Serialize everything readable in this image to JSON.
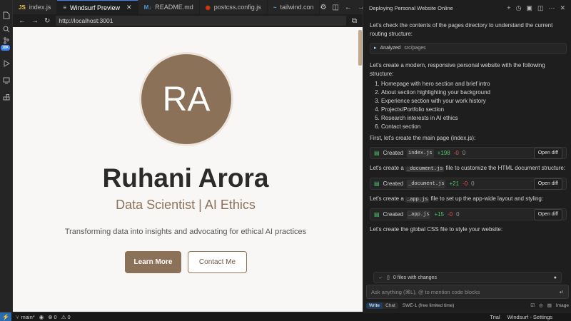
{
  "tabs": [
    {
      "icon": "JS",
      "label": "index.js",
      "active": false
    },
    {
      "icon": "≡",
      "label": "Windsurf Preview",
      "active": true
    },
    {
      "icon": "M↓",
      "label": "README.md",
      "active": false
    },
    {
      "icon": "◉",
      "label": "postcss.config.js",
      "active": false
    },
    {
      "icon": "~",
      "label": "tailwind.con",
      "active": false
    }
  ],
  "address": {
    "url": "http://localhost:3001"
  },
  "activity_badge": "10K",
  "preview": {
    "avatar_initials": "RA",
    "name": "Ruhani Arora",
    "role": "Data Scientist | AI Ethics",
    "tagline": "Transforming data into insights and advocating for ethical AI practices",
    "primary_button": "Learn More",
    "secondary_button": "Contact Me"
  },
  "chat": {
    "title": "Deploying Personal Website Online",
    "intro": "Let's check the contents of the pages directory to understand the current routing structure:",
    "analyzed_label": "Analyzed",
    "analyzed_path": "src/pages",
    "plan_intro": "Let's create a modern, responsive personal website with the following structure:",
    "plan_items": [
      "Homepage with hero section and brief intro",
      "About section highlighting your background",
      "Experience section with your work history",
      "Projects/Portfolio section",
      "Research interests in AI ethics",
      "Contact section"
    ],
    "main_page_text": "First, let's create the main page (index.js):",
    "created_label": "Created",
    "open_diff_label": "Open diff",
    "files": [
      {
        "name": "index.js",
        "added": "+198",
        "removed": "-0",
        "other": "0"
      },
      {
        "name": "_document.js",
        "added": "+21",
        "removed": "-0",
        "other": "0"
      },
      {
        "name": "_app.js",
        "added": "+15",
        "removed": "-0",
        "other": "0"
      }
    ],
    "document_text_before": "Let's create a",
    "document_code": "_document.js",
    "document_text_after": "file to customize the HTML document structure:",
    "app_text_before": "Let's create a",
    "app_code": "_app.js",
    "app_text_after": "file to set up the app-wide layout and styling:",
    "css_text": "Let's create the global CSS file to style your website:",
    "files_changes": "0 files with changes",
    "input_placeholder": "Ask anything (⌘L), @ to mention code blocks",
    "mode_write": "Write",
    "mode_chat": "Chat",
    "model": "SWE-1 (free limited time)",
    "image_label": "Image"
  },
  "status": {
    "branch": "main*",
    "errors": "0",
    "warnings": "0",
    "trial": "Trial",
    "settings": "Windsurf - Settings"
  }
}
